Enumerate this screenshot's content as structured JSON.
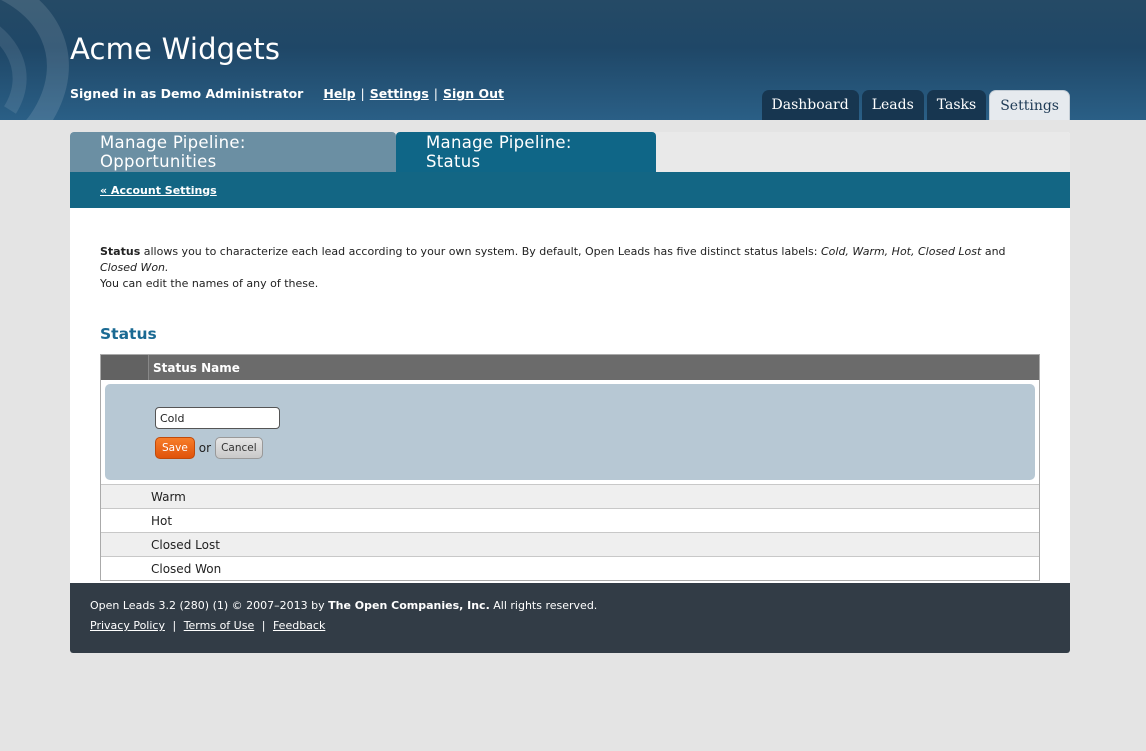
{
  "header": {
    "app_title": "Acme Widgets",
    "signed_in_text": "Signed in as Demo Administrator",
    "links": {
      "help": "Help",
      "settings": "Settings",
      "sign_out": "Sign Out"
    },
    "separator": "|"
  },
  "main_tabs": [
    {
      "label": "Dashboard",
      "active": false
    },
    {
      "label": "Leads",
      "active": false
    },
    {
      "label": "Tasks",
      "active": false
    },
    {
      "label": "Settings",
      "active": true
    }
  ],
  "sub_tabs": [
    {
      "label": "Manage Pipeline: Opportunities",
      "active": false
    },
    {
      "label": "Manage Pipeline: Status",
      "active": true
    }
  ],
  "breadcrumb": {
    "back_link": "« Account Settings"
  },
  "description": {
    "bold_lead": "Status",
    "text_1": " allows you to characterize each lead according to your own system. By default, Open Leads has five distinct status labels: ",
    "labels": "Cold, Warm, Hot, Closed Lost",
    "and": " and ",
    "last_label": "Closed Won.",
    "text_2": "You can edit the names of any of these."
  },
  "section_title": "Status",
  "table": {
    "header_name": "Status Name",
    "edit_row": {
      "input_value": "Cold",
      "save_label": "Save",
      "or_text": "or",
      "cancel_label": "Cancel"
    },
    "rows": [
      "Warm",
      "Hot",
      "Closed Lost",
      "Closed Won"
    ]
  },
  "footer": {
    "version_text": "Open Leads 3.2 (280) (1) © 2007–2013 by ",
    "company": "The Open Companies, Inc.",
    "rights": " All rights reserved.",
    "links": {
      "privacy": "Privacy Policy",
      "terms": "Terms of Use",
      "feedback": "Feedback"
    },
    "separator": "|"
  },
  "colors": {
    "header_bg": "#1f4767",
    "subtab_active": "#0f6687",
    "subtab_inactive": "#6b8fa3",
    "section_title": "#1a6a93",
    "save_button": "#f26a1b",
    "edit_box": "#b7c8d4",
    "footer_bg": "#323c46"
  }
}
